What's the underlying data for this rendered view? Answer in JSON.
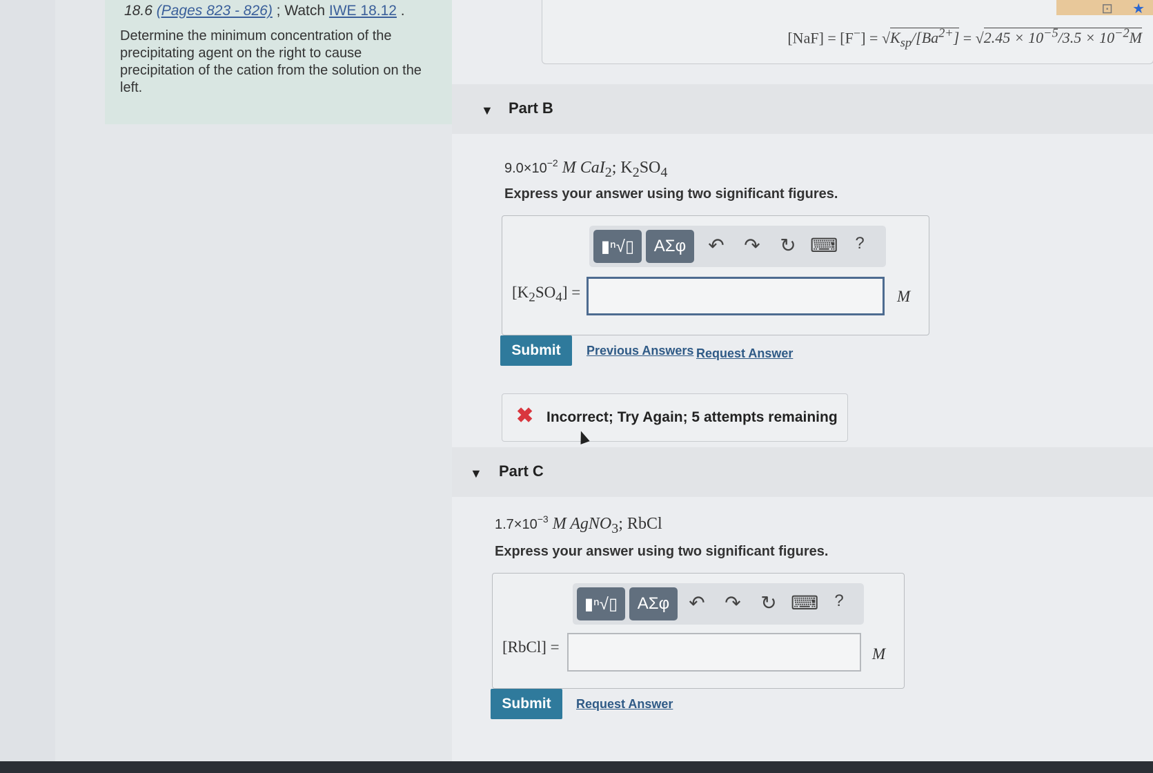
{
  "intro": {
    "ref_prefix": "18.6 ",
    "pages_link": "(Pages 823 - 826)",
    "watch_text": " ; Watch ",
    "watch_link": "IWE 18.12",
    "watch_suffix": " .",
    "text": "Determine the minimum concentration of the precipitating agent on the right to cause precipitation of the cation from the solution on the left."
  },
  "previous_formula": {
    "lhs": "[NaF] = [F",
    "minus": "−",
    "mid": "] = ",
    "rad1": "K",
    "rad1_sub": "sp",
    "rad1_rest": "/[Ba",
    "rad1_sup": "2+",
    "rad1_end": "]",
    "eq": " = ",
    "rad2": "2.45 × 10",
    "rad2_sup1": "−5",
    "rad2_mid": "/3.5 × 10",
    "rad2_sup2": "−2",
    "unit": "M"
  },
  "part_b": {
    "label": "Part B",
    "q_num": "9.0×10",
    "q_exp": "−2",
    "q_rest": " M CaI",
    "q_sub1": "2",
    "q_rest2": "; K",
    "q_sub2": "2",
    "q_rest3": "SO",
    "q_sub3": "4",
    "express": "Express your answer using two significant figures.",
    "answer_label_pre": "[K",
    "answer_label_sub1": "2",
    "answer_label_mid": "SO",
    "answer_label_sub2": "4",
    "answer_label_post": "] =",
    "unit": "M",
    "submit": "Submit",
    "previous_answers": "Previous Answers",
    "request_answer": "Request Answer",
    "feedback": "Incorrect; Try Again; 5 attempts remaining"
  },
  "part_c": {
    "label": "Part C",
    "q_num": "1.7×10",
    "q_exp": "−3",
    "q_rest": " M AgNO",
    "q_sub1": "3",
    "q_rest2": "; RbCl",
    "express": "Express your answer using two significant figures.",
    "answer_label": "[RbCl] =",
    "unit": "M",
    "submit": "Submit",
    "request_answer": "Request Answer"
  },
  "toolbar": {
    "templates_label": "▮ⁿ√▯",
    "greek_label": "ΑΣφ",
    "undo": "↶",
    "redo": "↷",
    "reset": "↻",
    "keyboard": "⌨",
    "help": "?"
  },
  "top_icons": {
    "tab": "⊡",
    "star": "★"
  }
}
